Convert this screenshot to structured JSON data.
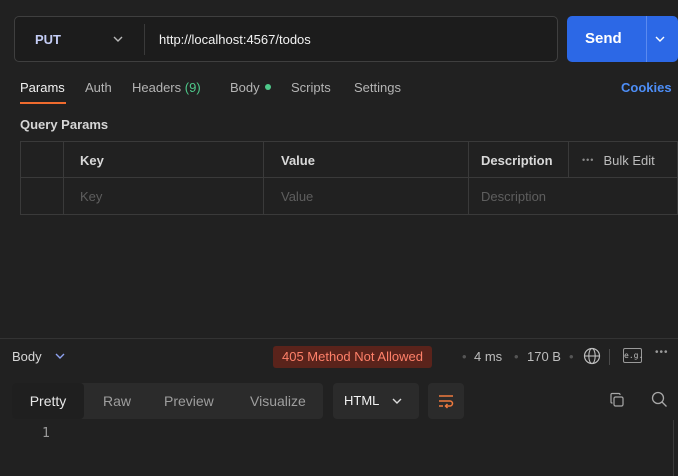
{
  "request": {
    "method": "PUT",
    "url": "http://localhost:4567/todos",
    "send_label": "Send"
  },
  "request_tabs": [
    {
      "label": "Params"
    },
    {
      "label": "Auth"
    },
    {
      "label": "Headers",
      "count": "(9)"
    },
    {
      "label": "Body"
    },
    {
      "label": "Scripts"
    },
    {
      "label": "Settings"
    }
  ],
  "cookies_label": "Cookies",
  "query_params": {
    "title": "Query Params",
    "columns": {
      "key": "Key",
      "value": "Value",
      "description": "Description",
      "bulk_edit": "Bulk Edit"
    },
    "placeholders": {
      "key": "Key",
      "value": "Value",
      "description": "Description"
    }
  },
  "response": {
    "body_label": "Body",
    "status": "405 Method Not Allowed",
    "time": "4 ms",
    "size": "170 B",
    "example_label": "e.g.",
    "view_tabs": [
      "Pretty",
      "Raw",
      "Preview",
      "Visualize"
    ],
    "format": "HTML",
    "line_numbers": [
      "1"
    ]
  },
  "colors": {
    "accent": "#2c68e6",
    "tab_underline": "#f06b2e",
    "status_error": "#ff8069",
    "success": "#4ec98a",
    "link": "#4d8ef7"
  }
}
